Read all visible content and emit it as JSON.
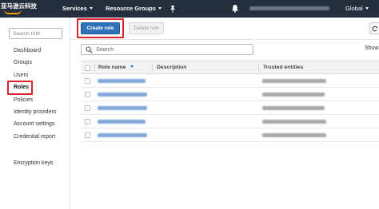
{
  "nav": {
    "brand": "亚马逊云科技",
    "services_label": "Services",
    "resource_groups_label": "Resource Groups",
    "region_label": "Global",
    "colors": {
      "bar": "#232f3e",
      "accent": "#ff9900"
    }
  },
  "sidebar": {
    "search_placeholder": "Search IAM",
    "items": [
      {
        "label": "Dashboard"
      },
      {
        "label": "Groups"
      },
      {
        "label": "Users"
      },
      {
        "label": "Roles",
        "active": true
      },
      {
        "label": "Policies"
      },
      {
        "label": "Identity providers"
      },
      {
        "label": "Account settings"
      },
      {
        "label": "Credential report"
      },
      {
        "label": "Encryption keys"
      }
    ]
  },
  "toolbar": {
    "create_label": "Create role",
    "delete_label": "Delete role",
    "refresh_icon": "refresh-icon",
    "colors": {
      "primary": "#2e73b8",
      "highlight": "#d9232b"
    }
  },
  "search": {
    "placeholder": "Search",
    "show_label": "Show"
  },
  "table": {
    "columns": [
      "Role name",
      "Description",
      "Trusted entities"
    ],
    "sorted_column": "Role name",
    "row_count": 5
  }
}
